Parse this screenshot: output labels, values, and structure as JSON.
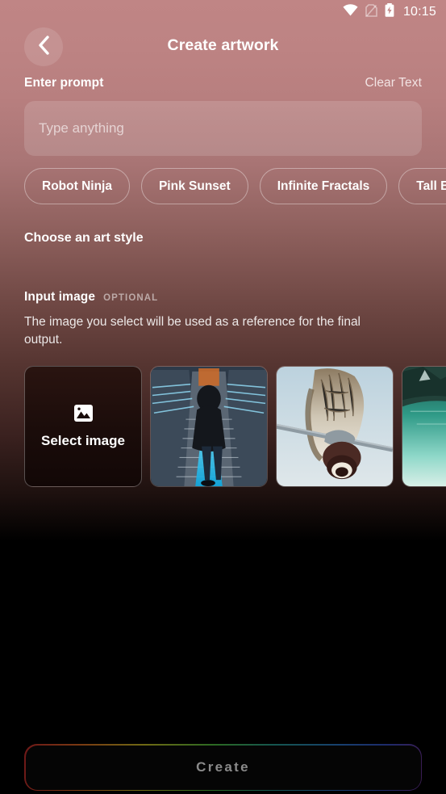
{
  "status_bar": {
    "time": "10:15",
    "icons": [
      "wifi-icon",
      "no-sim-icon",
      "battery-charging-icon"
    ]
  },
  "header": {
    "back_icon": "chevron-left-icon",
    "title": "Create artwork"
  },
  "prompt_section": {
    "label": "Enter prompt",
    "clear_label": "Clear Text",
    "input_value": "",
    "input_placeholder": "Type anything",
    "suggestions": [
      {
        "label": "Robot Ninja"
      },
      {
        "label": "Pink Sunset"
      },
      {
        "label": "Infinite Fractals"
      },
      {
        "label": "Tall Bird"
      }
    ]
  },
  "art_style_section": {
    "title": "Choose an art style"
  },
  "input_image_section": {
    "title": "Input image",
    "badge": "OPTIONAL",
    "description": "The image you select will be used as a reference for the final output.",
    "select_card": {
      "label": "Select image",
      "icon": "image-placeholder-icon"
    },
    "thumbnails": [
      {
        "name": "escalator-neon-photo",
        "description": "Person in hooded jacket on stairs with blue neon lighting"
      },
      {
        "name": "bird-power-line-photo",
        "description": "Bird perched on a power line insulator against pale sky"
      },
      {
        "name": "turquoise-lake-boat-photo",
        "description": "Wooden boat on a turquoise mountain lake"
      }
    ]
  },
  "footer": {
    "create_label": "Create"
  },
  "colors": {
    "background_top": "#c08585",
    "background_bottom": "#000000",
    "text_primary": "#ffffff",
    "create_text": "#8a8a8a"
  }
}
